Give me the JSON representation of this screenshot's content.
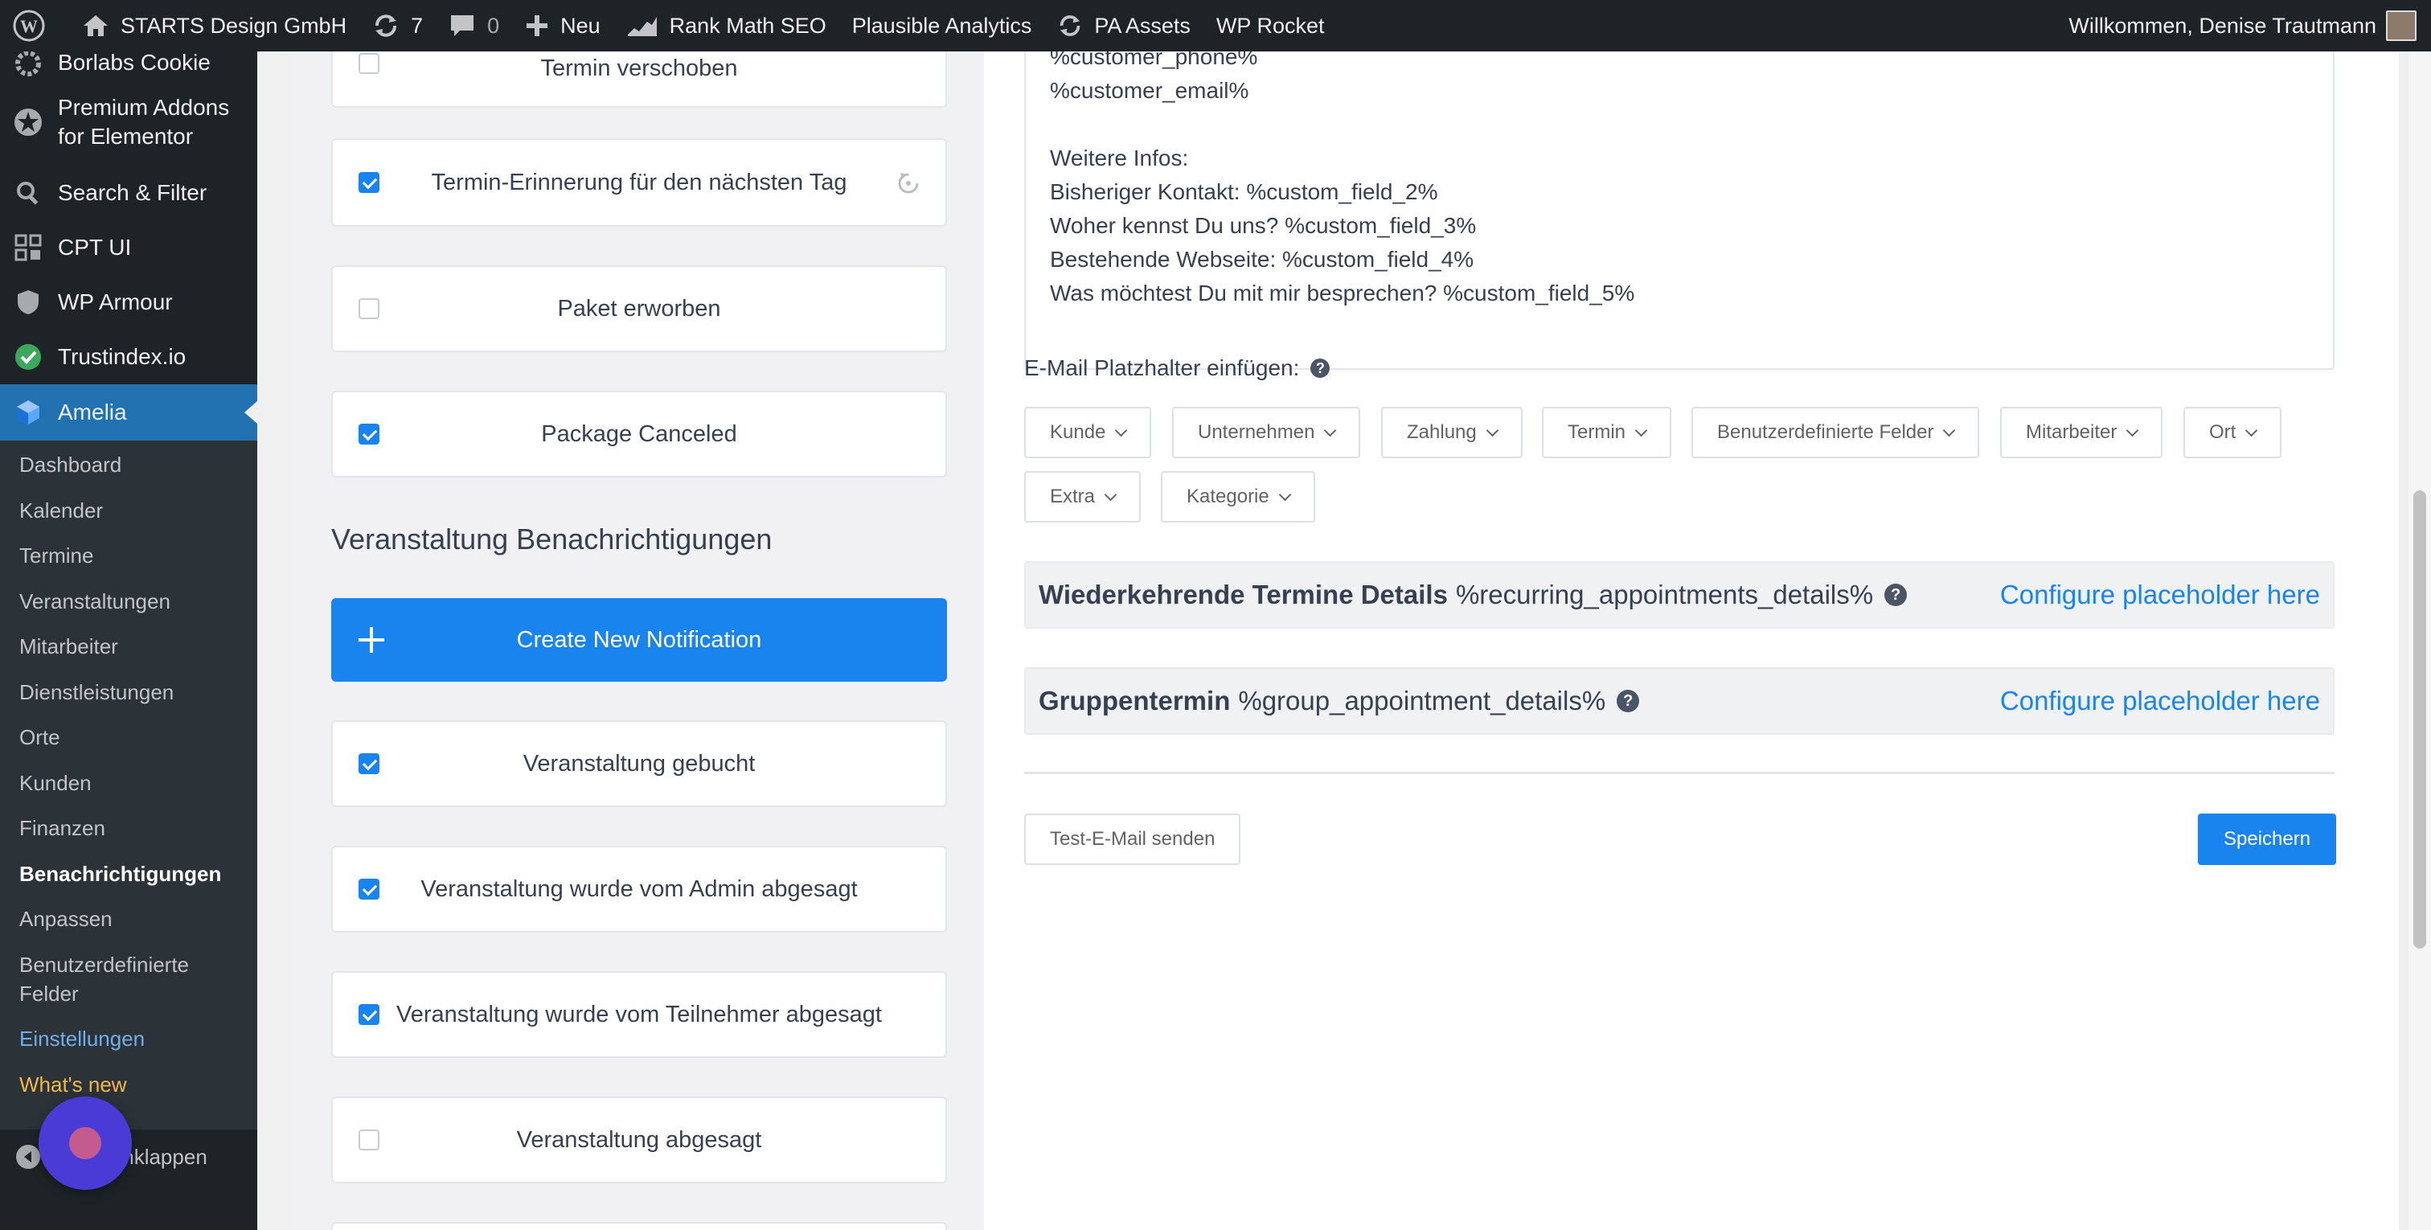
{
  "adminbar": {
    "site_name": "STARTS Design GmbH",
    "updates_count": "7",
    "comments_count": "0",
    "new_label": "Neu",
    "rank_math": "Rank Math SEO",
    "plausible": "Plausible Analytics",
    "pa_assets": "PA Assets",
    "wp_rocket": "WP Rocket",
    "greeting": "Willkommen, Denise Trautmann"
  },
  "sidebar": {
    "menu": [
      {
        "label": "Borlabs Cookie",
        "icon": "borlabs-icon"
      },
      {
        "label": "Premium Addons for Elementor",
        "line1": "Premium Addons",
        "line2": "for Elementor",
        "icon": "premium-addons-icon"
      },
      {
        "label": "Search & Filter",
        "icon": "search-icon"
      },
      {
        "label": "CPT UI",
        "icon": "cpt-ui-icon"
      },
      {
        "label": "WP Armour",
        "icon": "shield-icon"
      },
      {
        "label": "Trustindex.io",
        "icon": "trustindex-icon"
      },
      {
        "label": "Amelia",
        "icon": "amelia-icon"
      }
    ],
    "submenu": [
      "Dashboard",
      "Kalender",
      "Termine",
      "Veranstaltungen",
      "Mitarbeiter",
      "Dienstleistungen",
      "Orte",
      "Kunden",
      "Finanzen",
      "Benachrichtigungen",
      "Anpassen",
      "Benutzerdefinierte",
      "Einstellungen",
      "What's new"
    ],
    "submenu_line2": "Felder",
    "collapse_label": "Menü einklappen",
    "collapse_visible": "einklappen"
  },
  "notifications": {
    "top_partial": "Termin verschoben",
    "cards_top": [
      {
        "label": "Termin-Erinnerung für den nächsten Tag",
        "checked": true
      },
      {
        "label": "Paket erworben",
        "checked": false
      },
      {
        "label": "Package Canceled",
        "checked": true
      }
    ],
    "section_heading": "Veranstaltung Benachrichtigungen",
    "create_button": "Create New Notification",
    "cards_events": [
      {
        "label": "Veranstaltung gebucht",
        "checked": true
      },
      {
        "label": "Veranstaltung wurde vom Admin abgesagt",
        "checked": true
      },
      {
        "label": "Veranstaltung wurde vom Teilnehmer abgesagt",
        "checked": true
      },
      {
        "label": "Veranstaltung abgesagt",
        "checked": false
      }
    ]
  },
  "editor": {
    "lines": [
      "%customer_phone%",
      "%customer_email%",
      "",
      "Weitere Infos:",
      "Bisheriger Kontakt: %custom_field_2%",
      "Woher kennst Du uns? %custom_field_3%",
      "Bestehende Webseite: %custom_field_4%",
      "Was möchtest Du mit mir besprechen? %custom_field_5%"
    ]
  },
  "placeholders": {
    "label": "E-Mail Platzhalter einfügen:",
    "dropdowns_row1": [
      "Kunde",
      "Unternehmen",
      "Zahlung",
      "Termin",
      "Benutzerdefinierte Felder",
      "Mitarbeiter",
      "Ort"
    ],
    "dropdowns_row2": [
      "Extra",
      "Kategorie"
    ],
    "recurring": {
      "title": "Wiederkehrende Termine Details",
      "code": "%recurring_appointments_details%",
      "link": "Configure placeholder here"
    },
    "group": {
      "title": "Gruppentermin",
      "code": "%group_appointment_details%",
      "link": "Configure placeholder here"
    }
  },
  "actions": {
    "test_email": "Test-E-Mail senden",
    "save": "Speichern"
  },
  "colors": {
    "accent": "#1a84ee",
    "wp_dark": "#1d2327",
    "wp_blue": "#2271b1"
  }
}
